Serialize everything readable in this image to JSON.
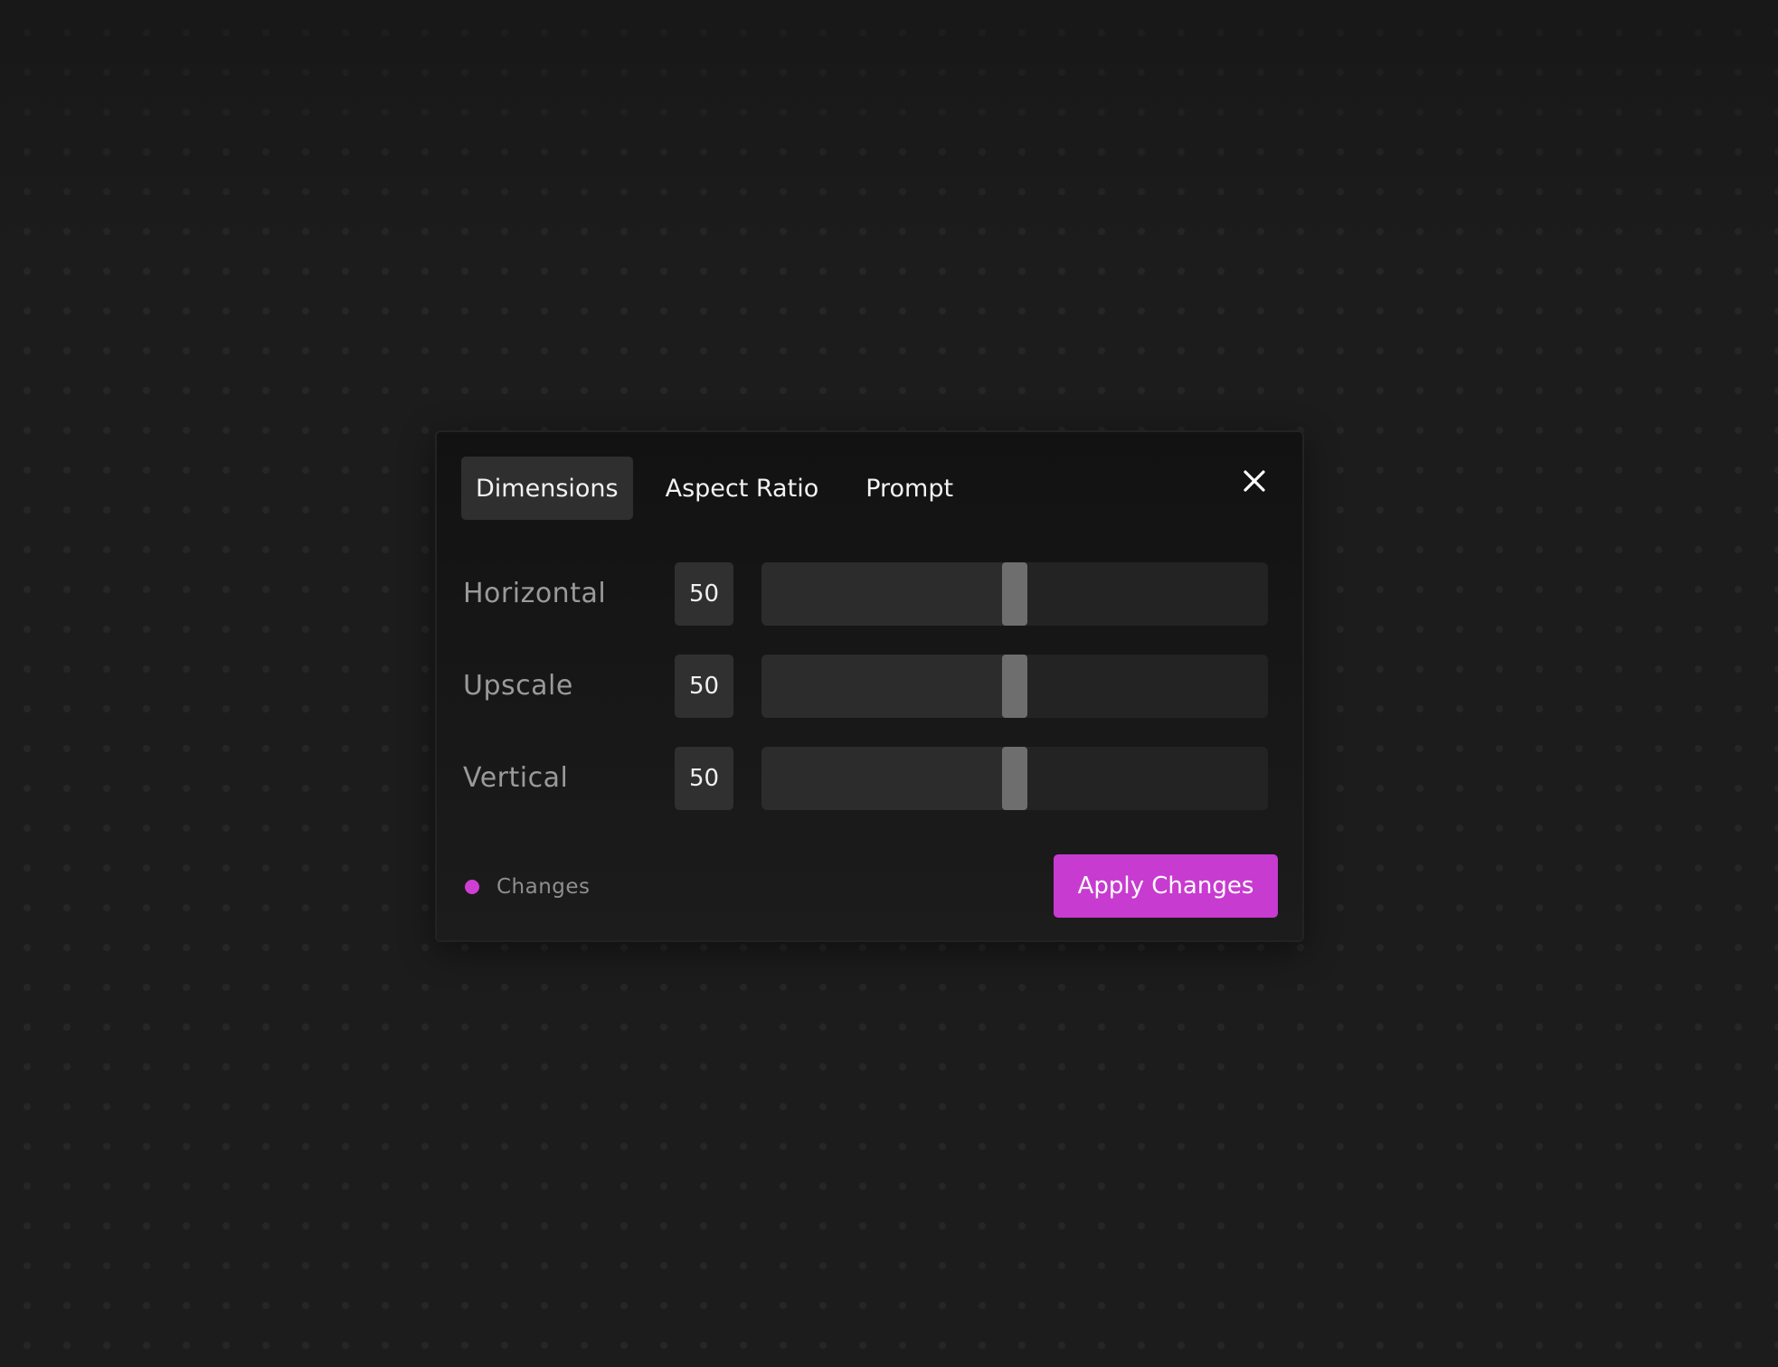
{
  "dialog": {
    "tabs": [
      {
        "label": "Dimensions",
        "active": true
      },
      {
        "label": "Aspect Ratio",
        "active": false
      },
      {
        "label": "Prompt",
        "active": false
      }
    ],
    "close_icon": "close-icon",
    "sliders": [
      {
        "label": "Horizontal",
        "value": "50",
        "level": 0.5
      },
      {
        "label": "Upscale",
        "value": "50",
        "level": 0.5
      },
      {
        "label": "Vertical",
        "value": "50",
        "level": 0.5
      }
    ],
    "footer": {
      "status_label": "Changes",
      "status_color": "#cf3fd3",
      "apply_label": "Apply Changes",
      "apply_color": "#c83bd0"
    }
  }
}
